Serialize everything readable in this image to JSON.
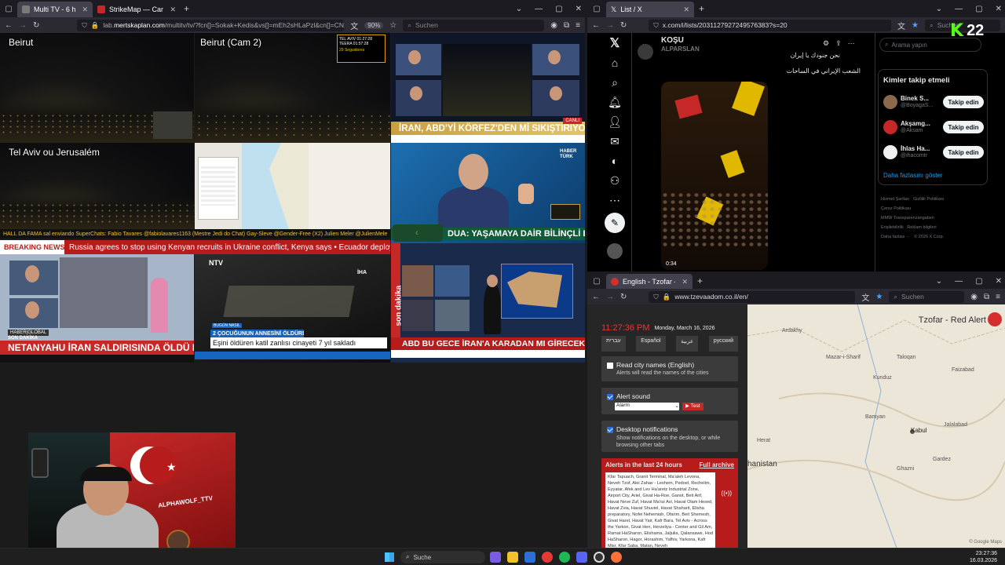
{
  "left_window": {
    "tabs": [
      {
        "label": "Multi TV - 6 haber kanalını",
        "active": true,
        "color": "#7a7a7a"
      },
      {
        "label": "StrikeMap — Canlı ABD/İsrail",
        "active": false,
        "color": "#c62828"
      }
    ],
    "url_prefix": "lab.",
    "url_domain": "mertskaplan.com",
    "url_path": "/multitv/tv/?fcn[]=Sokak+Kedis&vs[]=mEh2sHLaPzl&cn[]=CNN+Türk&",
    "zoom": "90%",
    "search_placeholder": "Suchen",
    "cams": {
      "beirut": "Beirut",
      "beirut2": "Beirut (Cam 2)",
      "tlv": "Tel Aviv ou Jerusalém"
    },
    "tlv_times": [
      "TEL AVIV 01:27:28",
      "TEERA 01:57:28"
    ],
    "cnn_headline": "İRAN, ABD'Yİ KÖRFEZ'DEN Mİ SIKIŞTIRIYOR",
    "cnn_badge": "CANLI",
    "haberturk_headline": "DUA: YAŞAMAYA DAİR BİLİNÇLİ BİR ADIM",
    "haberturk_logo": "HABER TÜRK",
    "hall_ticker": "HALL DA FAMA  sal enviando SuperChats:   Fabio Tavares @fabiolavares1163 (Mestre Jedi do Chat)   Gay-Sleve @Gender-Free (X2)   Julien Meler @JulienMele",
    "breaking_label": "BREAKING NEWS",
    "breaking_text": "Russia agrees to stop using Kenyan recruits in Ukraine conflict, Kenya says  •  Ecuador deploys 75,000",
    "haberglobal_headline": "NETANYAHU İRAN SALDIRISINDA ÖLDÜ MÜ?",
    "haberglobal_tag": "SON DAKİKA",
    "haberglobal_logo": "HABER|GLOBAL",
    "ntv_logo": "NTV",
    "ntv_tag": "2 ÇOCUĞUNUN ANNESİNİ ÖLDÜRDÜ",
    "ntv_headline": "Eşini öldüren katil zanlısı cinayeti 7 yıl sakladı",
    "ntv_small": "BUGÜN NASIL",
    "iha_logo": "İHA",
    "aht_headline": "ABD BU GECE İRAN'A KARADAN MI GİRECEK?",
    "aht_side": "son dakika",
    "streamer_banner": "ALPHAWOLF_TTV"
  },
  "x_window": {
    "tab_label": "List / X",
    "url": "x.com/i/lists/2031127927249576383?s=20",
    "search_placeholder": "Suchen",
    "list_title": "KOŞU",
    "author": "ALPARSLAN",
    "arabic_line1": "نحن جنودك يا إيران",
    "arabic_line2": "الشعب الإيراني في الساحات",
    "video_time": "0:34",
    "search_x_placeholder": "Arama yapın",
    "who_to_follow": "Kimler takip etmeli",
    "follow_list": [
      {
        "name": "Binek S...",
        "handle": "@BoyagaS...",
        "color": "#8a6a4a"
      },
      {
        "name": "Akşamg...",
        "handle": "@Aksam",
        "color": "#c62828"
      },
      {
        "name": "İhlas Ha...",
        "handle": "@ihacomtr",
        "color": "#f0f0f0"
      }
    ],
    "follow_label": "Takip edin",
    "show_more": "Daha fazlasını göster",
    "footer_links": [
      "Hizmet Şartları",
      "Gizlilik Politikası",
      "Çerez Politikası",
      "MMW Transparenzangaben",
      "Erişilebilirlik",
      "Reklam bilgileri",
      "Daha fazlası ···",
      "© 2026 X Corp."
    ],
    "k_badge": "22"
  },
  "tzofar_window": {
    "tab_label": "English - Tzofar - Red Alert",
    "url": "www.tzevaadom.co.il/en/",
    "search_placeholder": "Suchen",
    "time": "11:27:36 PM",
    "date": "Monday, March 16, 2026",
    "languages": [
      "עברית",
      "Español",
      "عربية",
      "русский"
    ],
    "read_names_title": "Read city names (English)",
    "read_names_desc": "Alerts will read the names of the cities",
    "alert_sound_title": "Alert sound",
    "alert_sound_value": "Alarm",
    "test_label": "▶ Test",
    "desktop_title": "Desktop notifications",
    "desktop_desc": "Show notifications on the desktop, or while browsing other tabs",
    "alerts_header": "Alerts in the last 24 hours",
    "full_archive": "Full archive",
    "alerts_text": "Kfar Tapuach, Granit Terminal, Ma'aleh Levona, Neveh Tzof, Alei Zahav - Leshem, Pedoel, Rechelim, Eyyatar, Afek and Lev Ha'aretz Industrial Zone, Airport City, Ariel, Givat Ha-Roe, Ganot, Beit Arif, Havat Neve Zuf, Havat Ma'oz Avi, Havat Olam Hesed, Havat Zvia, Havat Shuviel, Havat Shaharit, Elisha preparatory, Nofei Nehemiah, Ofarim, Beit Shemesh, Givat Harel, Havat Yair, Kafr Bara, Tel Aviv - Across the Yarkon, Givat Hen, Herzeliya - Center and Gil Am, Ramat HaSharon, Elishama, Jaljulia, Qalansawe, Hod HaSharon, Hagor, Horashim, Yafhiv, Yarkona, Kafr Misr, Kfar Saba, Matan, Neveh",
    "map_title": "Tzofar - Red Alert",
    "map_labels": [
      "Ardakhy",
      "Mazar-i-Sharif",
      "Taloqan",
      "Kunduz",
      "Faizabad",
      "Kabul",
      "Jalalabad",
      "Bamyan",
      "Ghazni",
      "Gardez",
      "Herat"
    ],
    "map_country": "hanistan",
    "map_credit": "© Google Maps"
  },
  "taskbar": {
    "search_label": "Suche",
    "time": "23:27:36",
    "date": "16.03.2026"
  },
  "colors": {
    "firefox_bg": "#1c1b22",
    "firefox_toolbar": "#2b2a33",
    "tzofar_red": "#d32f2f",
    "breaking_red": "#c62828",
    "x_blue": "#1d9bf0"
  }
}
